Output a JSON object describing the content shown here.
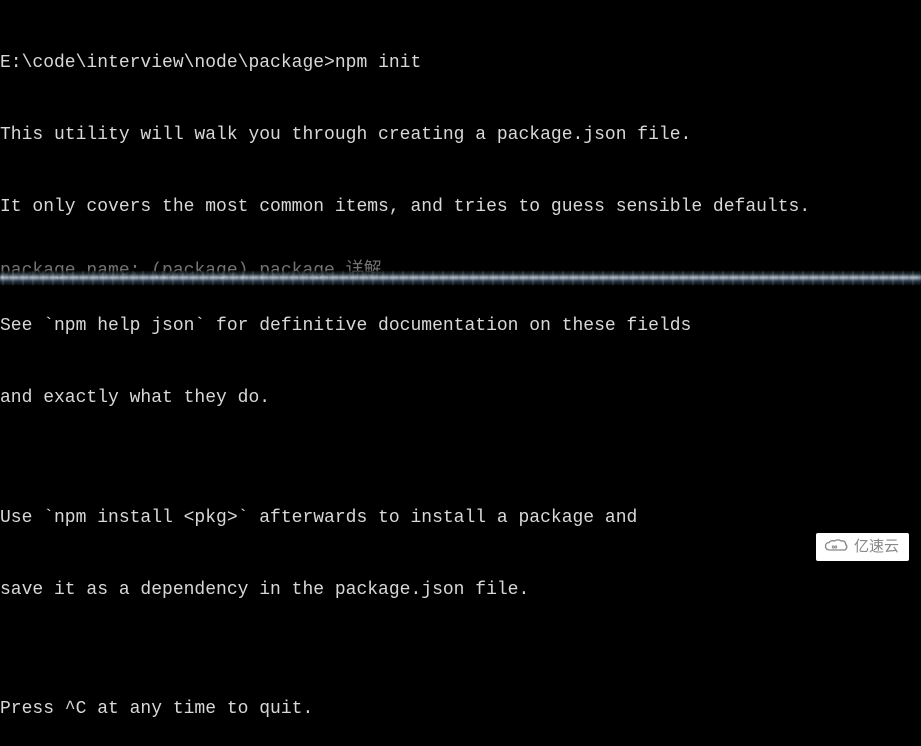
{
  "terminal": {
    "prompt": "E:\\code\\interview\\node\\package>",
    "command": "npm init",
    "lines": [
      "This utility will walk you through creating a package.json file.",
      "It only covers the most common items, and tries to guess sensible defaults.",
      "",
      "See `npm help json` for definitive documentation on these fields",
      "and exactly what they do.",
      "",
      "Use `npm install <pkg>` afterwards to install a package and",
      "save it as a dependency in the package.json file.",
      "",
      "Press ^C at any time to quit."
    ],
    "partial_line": "package name: (package) package 详解"
  },
  "watermark": {
    "text": "亿速云",
    "icon_name": "cloud-infinity"
  }
}
